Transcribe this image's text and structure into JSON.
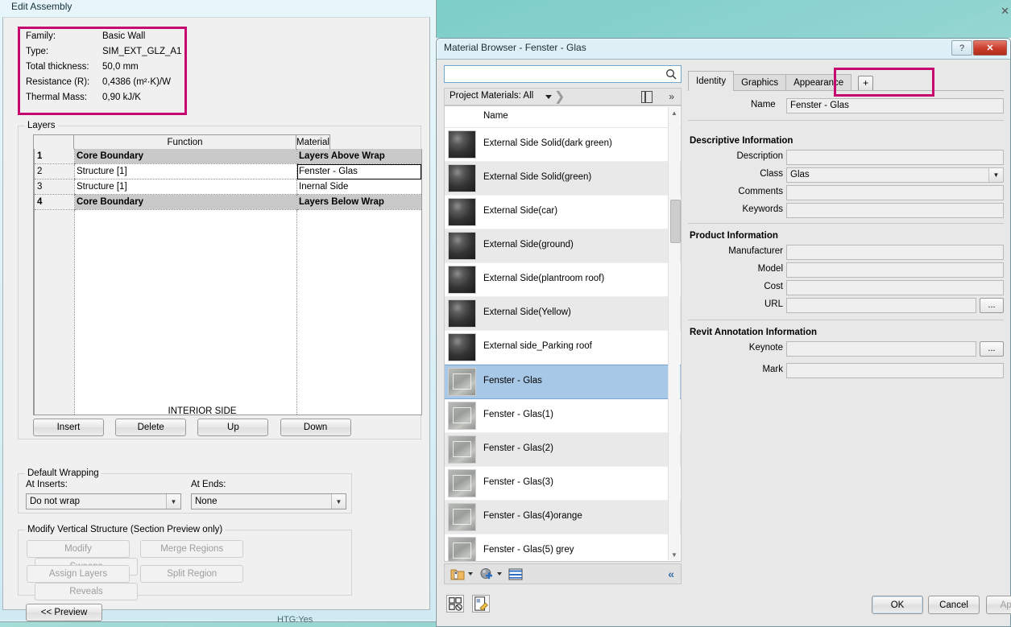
{
  "edit_assembly": {
    "title": "Edit Assembly",
    "properties": [
      {
        "label": "Family:",
        "value": "Basic Wall"
      },
      {
        "label": "Type:",
        "value": "SIM_EXT_GLZ_A1"
      },
      {
        "label": "Total thickness:",
        "value": "50,0 mm"
      },
      {
        "label": "Resistance (R):",
        "value": "0,4386 (m²·K)/W"
      },
      {
        "label": "Thermal Mass:",
        "value": "0,90 kJ/K"
      }
    ],
    "layers_group_label": "Layers",
    "table": {
      "headers": [
        "",
        "Function",
        "Material"
      ],
      "rows": [
        {
          "num": "1",
          "function": "Core Boundary",
          "material": "Layers Above Wrap",
          "core": true,
          "selected": false
        },
        {
          "num": "2",
          "function": "Structure [1]",
          "material": "Fenster - Glas",
          "core": false,
          "selected": true
        },
        {
          "num": "3",
          "function": "Structure [1]",
          "material": "Inernal Side",
          "core": false,
          "selected": false
        },
        {
          "num": "4",
          "function": "Core Boundary",
          "material": "Layers Below Wrap",
          "core": true,
          "selected": false
        }
      ]
    },
    "interior_side_label": "INTERIOR SIDE",
    "layer_buttons": [
      "Insert",
      "Delete",
      "Up",
      "Down"
    ],
    "default_wrapping": {
      "group_label": "Default Wrapping",
      "at_inserts_label": "At Inserts:",
      "at_inserts_value": "Do not wrap",
      "at_ends_label": "At  Ends:",
      "at_ends_value": "None"
    },
    "vertical_structure": {
      "group_label": "Modify Vertical Structure (Section Preview only)",
      "buttons": [
        "Modify",
        "Merge Regions",
        "Sweeps",
        "Assign Layers",
        "Split Region",
        "Reveals"
      ]
    },
    "preview_button": "<< Preview",
    "status_text": "HTG:Yes"
  },
  "material_browser": {
    "title": "Material Browser - Fenster - Glas",
    "help_button": "?",
    "close_button": "✕",
    "search": {
      "value": "",
      "placeholder": "",
      "icon": "search-icon"
    },
    "filter_bar": {
      "label": "Project Materials: All",
      "pane_icon": "panel-toggle-icon",
      "expand_icon": "»"
    },
    "list": {
      "column_header": "Name",
      "items": [
        {
          "name": "External Side Solid(dark green)",
          "swatch": "sphere",
          "selected": false
        },
        {
          "name": "External Side Solid(green)",
          "swatch": "sphere",
          "selected": false
        },
        {
          "name": "External Side(car)",
          "swatch": "sphere",
          "selected": false
        },
        {
          "name": "External Side(ground)",
          "swatch": "sphere",
          "selected": false
        },
        {
          "name": "External Side(plantroom roof)",
          "swatch": "sphere",
          "selected": false
        },
        {
          "name": "External Side(Yellow)",
          "swatch": "sphere",
          "selected": false
        },
        {
          "name": "External side_Parking roof",
          "swatch": "sphere",
          "selected": false
        },
        {
          "name": "Fenster - Glas",
          "swatch": "glass",
          "selected": true
        },
        {
          "name": "Fenster - Glas(1)",
          "swatch": "glass",
          "selected": false
        },
        {
          "name": "Fenster - Glas(2)",
          "swatch": "glass",
          "selected": false
        },
        {
          "name": "Fenster - Glas(3)",
          "swatch": "glass",
          "selected": false
        },
        {
          "name": "Fenster - Glas(4)orange",
          "swatch": "glass",
          "selected": false
        },
        {
          "name": "Fenster - Glas(5) grey",
          "swatch": "glass",
          "selected": false
        },
        {
          "name": "",
          "swatch": "box",
          "selected": false
        }
      ]
    },
    "list_toolbar": {
      "new_material_icon": "new-material-library-icon",
      "new_asset_icon": "new-asset-icon",
      "list_view_icon": "list-view-icon",
      "collapse_icon": "«"
    },
    "tabs": [
      {
        "label": "Identity",
        "active": true
      },
      {
        "label": "Graphics",
        "active": false
      },
      {
        "label": "Appearance",
        "active": false
      }
    ],
    "add_tab_button": "+",
    "identity": {
      "name_label": "Name",
      "name_value": "Fenster - Glas",
      "descriptive_section": "Descriptive Information",
      "descriptive_fields": [
        {
          "label": "Description",
          "value": "",
          "type": "text"
        },
        {
          "label": "Class",
          "value": "Glas",
          "type": "combo"
        },
        {
          "label": "Comments",
          "value": "",
          "type": "text"
        },
        {
          "label": "Keywords",
          "value": "",
          "type": "text"
        }
      ],
      "product_section": "Product Information",
      "product_fields": [
        {
          "label": "Manufacturer",
          "value": "",
          "type": "text"
        },
        {
          "label": "Model",
          "value": "",
          "type": "text"
        },
        {
          "label": "Cost",
          "value": "",
          "type": "text"
        },
        {
          "label": "URL",
          "value": "",
          "type": "browse"
        }
      ],
      "annotation_section": "Revit Annotation Information",
      "annotation_fields": [
        {
          "label": "Keynote",
          "value": "",
          "type": "browse"
        },
        {
          "label": "Mark",
          "value": "",
          "type": "text"
        }
      ],
      "browse_button_label": "..."
    },
    "footer": {
      "icon_left_1": "material-off-icon",
      "icon_left_2": "edit-material-icon",
      "ok": "OK",
      "cancel": "Cancel",
      "apply": "Apply"
    }
  },
  "highlights": {
    "color": "#c7056e",
    "regions": [
      "assembly-properties",
      "add-tab-button"
    ]
  }
}
